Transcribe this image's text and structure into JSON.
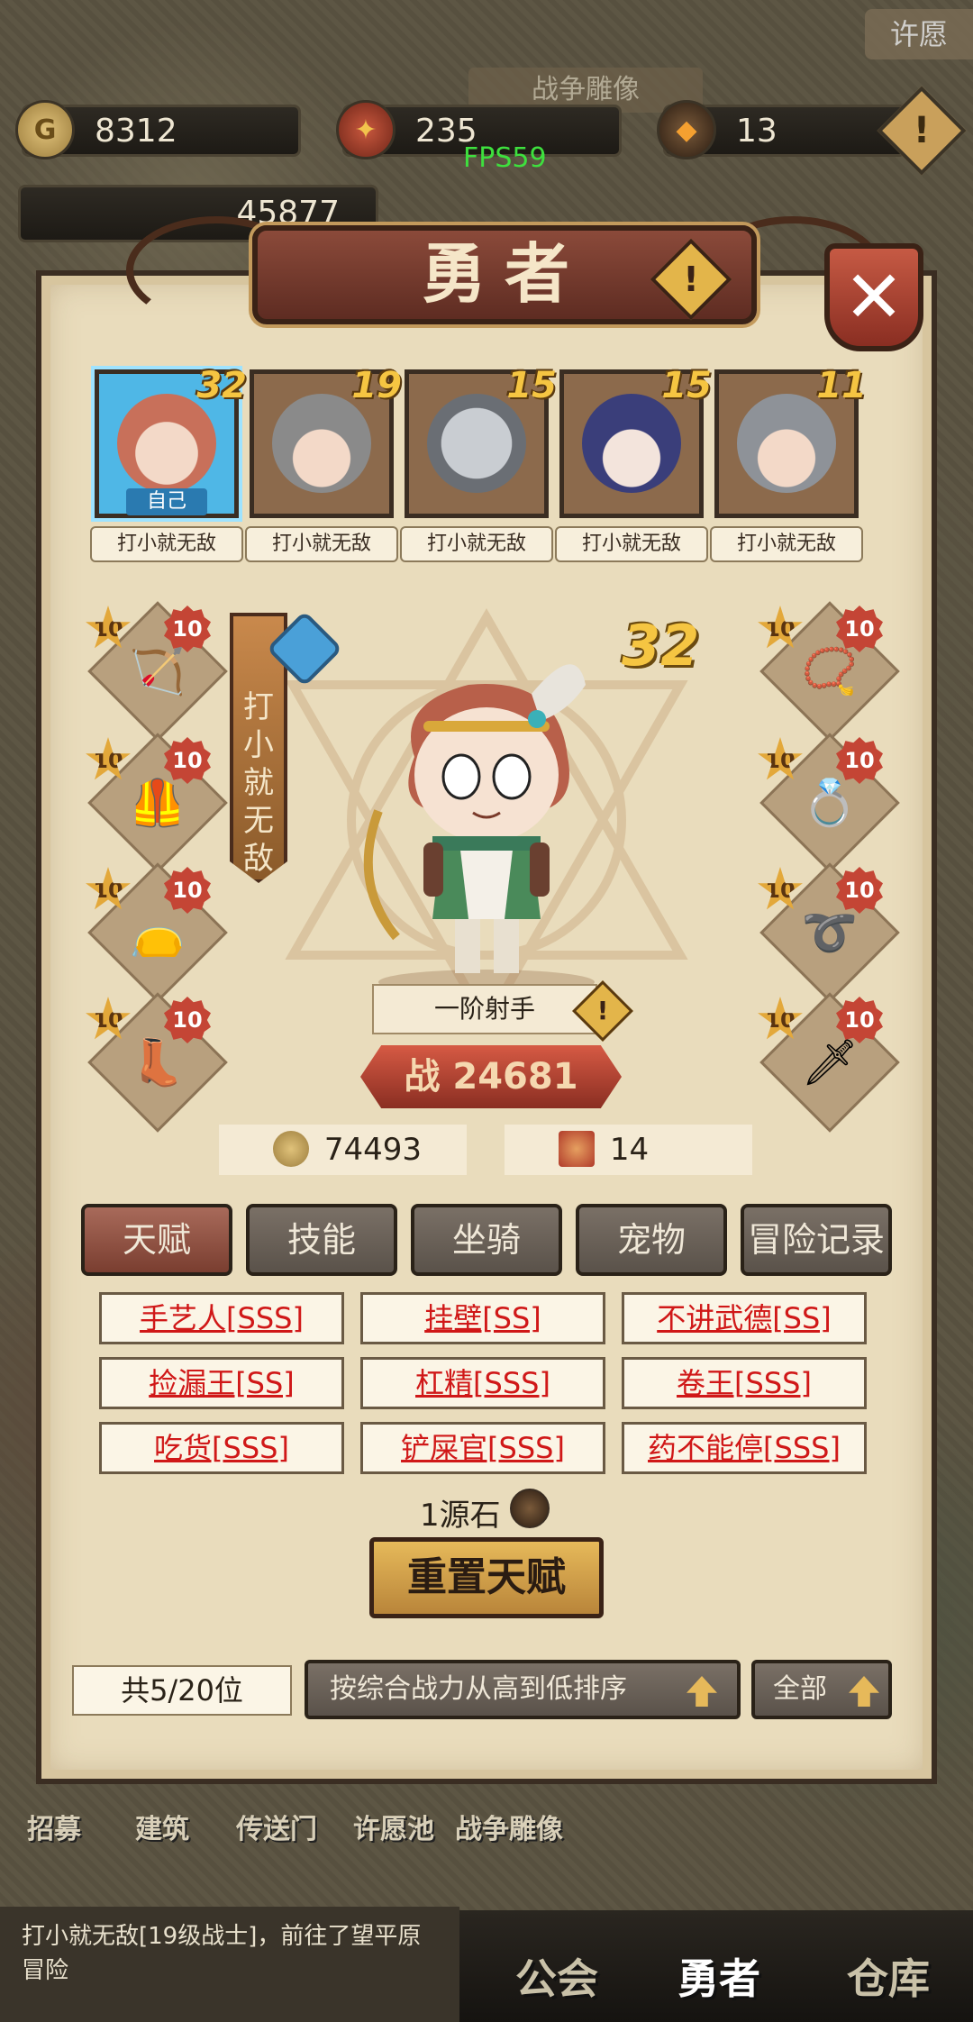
{
  "top": {
    "coins": "8312",
    "gems": "235",
    "stones": "13",
    "fps": "FPS59",
    "power": "45877",
    "banner": "战争雕像",
    "wish": "许愿"
  },
  "panel": {
    "title": "勇者",
    "close_symbol": "✕",
    "warn_symbol": "!"
  },
  "heroes": [
    {
      "level": "32",
      "name": "打小就无敌",
      "tag": "自己",
      "color": "#d9826a"
    },
    {
      "level": "19",
      "name": "打小就无敌",
      "color": "#b0a896"
    },
    {
      "level": "15",
      "name": "打小就无敌",
      "color": "#9aa0a8"
    },
    {
      "level": "15",
      "name": "打小就无敌",
      "color": "#7a6ab8"
    },
    {
      "level": "11",
      "name": "打小就无敌",
      "color": "#a0a4aa"
    }
  ],
  "equipment": {
    "left": [
      {
        "star": "10",
        "level": "10",
        "icon": "bow-icon",
        "glyph": "🏹"
      },
      {
        "star": "10",
        "level": "10",
        "icon": "armor-icon",
        "glyph": "🦺"
      },
      {
        "star": "10",
        "level": "10",
        "icon": "bag-icon",
        "glyph": "👝"
      },
      {
        "star": "10",
        "level": "10",
        "icon": "boots-icon",
        "glyph": "👢"
      }
    ],
    "right": [
      {
        "star": "10",
        "level": "10",
        "icon": "necklace-icon",
        "glyph": "📿"
      },
      {
        "star": "10",
        "level": "10",
        "icon": "ring-icon",
        "glyph": "💍"
      },
      {
        "star": "10",
        "level": "10",
        "icon": "belt-icon",
        "glyph": "➰"
      },
      {
        "star": "10",
        "level": "10",
        "icon": "dagger-icon",
        "glyph": "🗡"
      }
    ]
  },
  "selected_hero": {
    "name": "打小就无敌",
    "level": "32",
    "class": "一阶射手",
    "power_label": "战",
    "power": "24681",
    "gold": "74493",
    "scrolls": "14"
  },
  "tabs": [
    "天赋",
    "技能",
    "坐骑",
    "宠物",
    "冒险记录"
  ],
  "talents": [
    "手艺人[SSS]",
    "挂壁[SS]",
    "不讲武德[SS]",
    "捡漏王[SS]",
    "杠精[SSS]",
    "卷王[SSS]",
    "吃货[SSS]",
    "铲屎官[SSS]",
    "药不能停[SSS]"
  ],
  "reset": {
    "cost": "1源石",
    "button": "重置天赋"
  },
  "footer": {
    "count": "共5/20位",
    "sort": "按综合战力从高到低排序",
    "filter": "全部"
  },
  "nav_small": [
    "招募",
    "建筑",
    "传送门",
    "许愿池",
    "战争雕像"
  ],
  "message": "打小就无敌[19级战士]，前往了望平原冒险",
  "nav_big": [
    "公会",
    "勇者",
    "仓库"
  ]
}
